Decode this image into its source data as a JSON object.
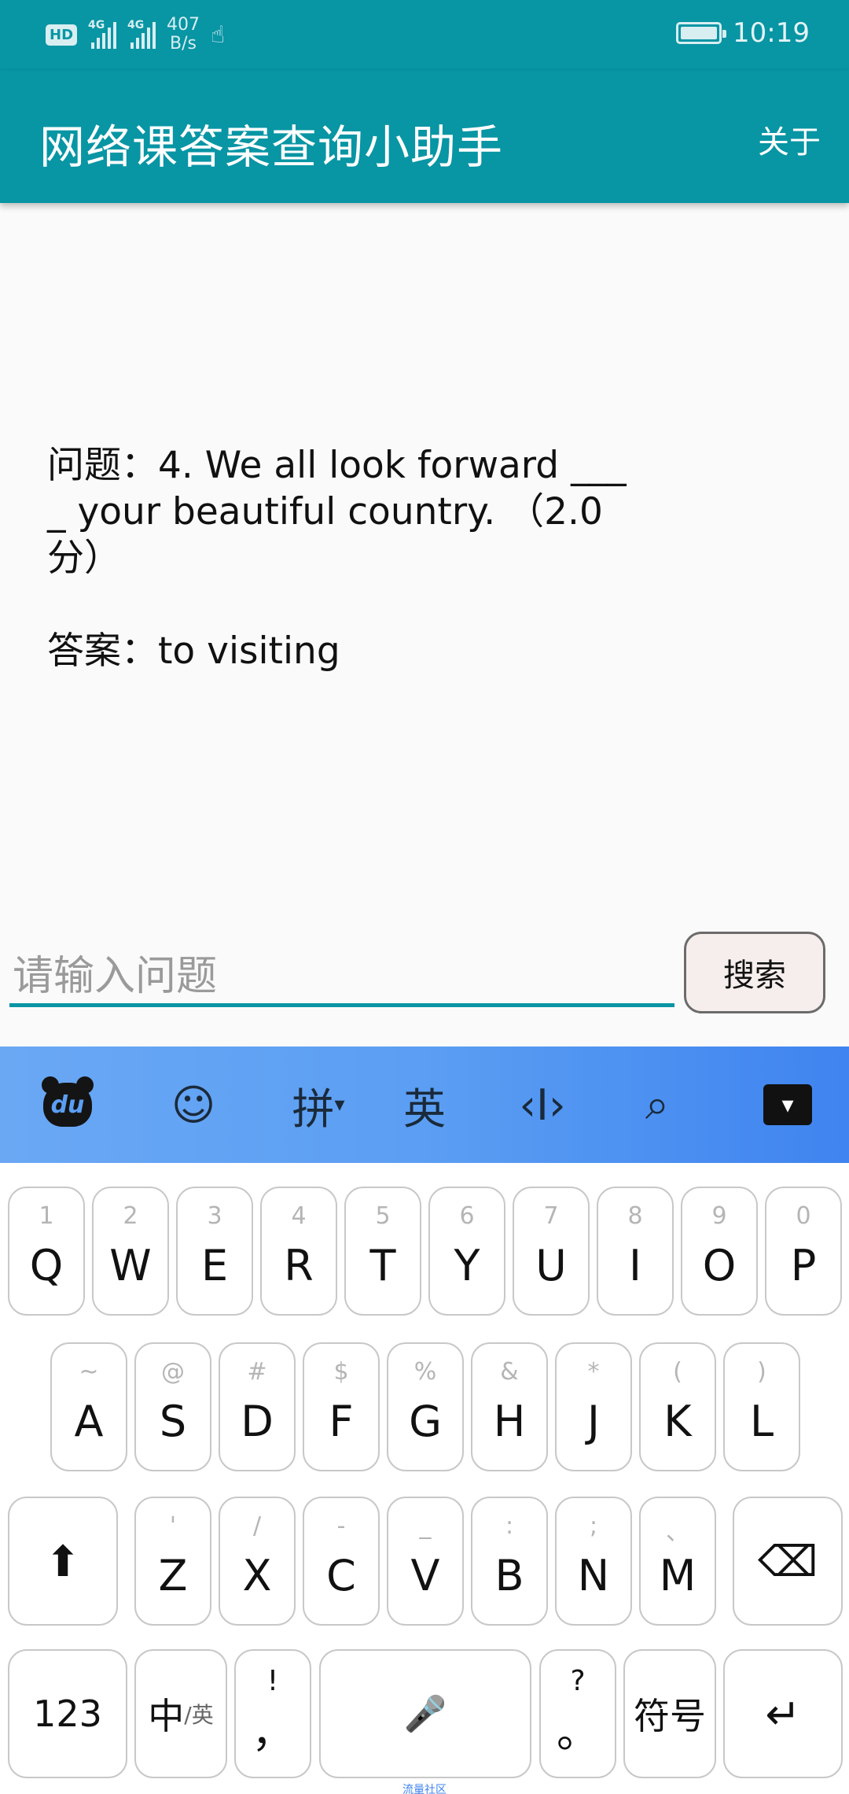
{
  "status_bar": {
    "hd": "HD",
    "network1": "4G",
    "network2": "4G",
    "speed_value": "407",
    "speed_unit": "B/s",
    "time": "10:19"
  },
  "app_bar": {
    "title": "网络课答案查询小助手",
    "about_label": "关于"
  },
  "content": {
    "question_line1": "问题：4. We all look forward ___",
    "question_line2": "_ your beautiful country. （2.0",
    "question_line3": "分）",
    "answer": "答案：to visiting"
  },
  "search": {
    "placeholder": "请输入问题",
    "button_label": "搜索"
  },
  "keyboard_toolbar": {
    "logo": "du",
    "emoji": "☺",
    "pinyin_label": "拼",
    "english_label": "英",
    "cursor": "‹I›",
    "search": "⌕",
    "hide": "▾"
  },
  "keyboard": {
    "row1": [
      {
        "main": "Q",
        "sub": "1"
      },
      {
        "main": "W",
        "sub": "2"
      },
      {
        "main": "E",
        "sub": "3"
      },
      {
        "main": "R",
        "sub": "4"
      },
      {
        "main": "T",
        "sub": "5"
      },
      {
        "main": "Y",
        "sub": "6"
      },
      {
        "main": "U",
        "sub": "7"
      },
      {
        "main": "I",
        "sub": "8"
      },
      {
        "main": "O",
        "sub": "9"
      },
      {
        "main": "P",
        "sub": "0"
      }
    ],
    "row2": [
      {
        "main": "A",
        "sub": "~"
      },
      {
        "main": "S",
        "sub": "@"
      },
      {
        "main": "D",
        "sub": "#"
      },
      {
        "main": "F",
        "sub": "$"
      },
      {
        "main": "G",
        "sub": "%"
      },
      {
        "main": "H",
        "sub": "&"
      },
      {
        "main": "J",
        "sub": "*"
      },
      {
        "main": "K",
        "sub": "("
      },
      {
        "main": "L",
        "sub": ")"
      }
    ],
    "row3": [
      {
        "main": "Z",
        "sub": "'"
      },
      {
        "main": "X",
        "sub": "/"
      },
      {
        "main": "C",
        "sub": "-"
      },
      {
        "main": "V",
        "sub": "_"
      },
      {
        "main": "B",
        "sub": ":"
      },
      {
        "main": "N",
        "sub": ";"
      },
      {
        "main": "M",
        "sub": "、"
      }
    ],
    "shift": "⬆",
    "backspace": "⌫",
    "num_key": "123",
    "lang_main": "中",
    "lang_sub": "/英",
    "comma_top": "!",
    "comma_main": "，",
    "space_icon": "🎤",
    "period_top": "?",
    "period_main": "。",
    "symbols": "符号",
    "enter": "↵"
  },
  "watermark": "流量社区"
}
